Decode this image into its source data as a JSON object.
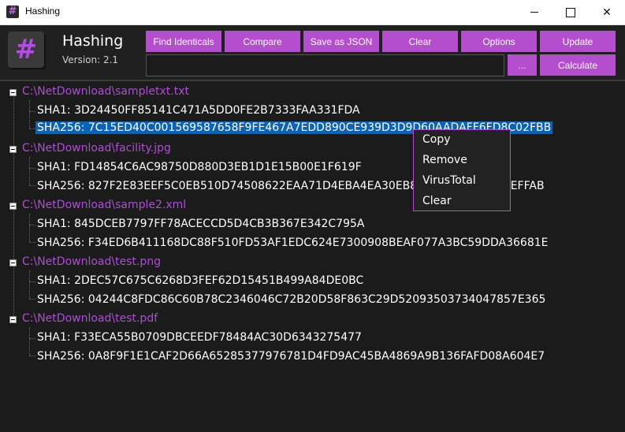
{
  "window": {
    "title": "Hashing",
    "icon": "hash-icon"
  },
  "header": {
    "logo_glyph": "#",
    "app_name": "Hashing",
    "version": "Version: 2.1",
    "buttons": {
      "find_identicals": "Find Identicals",
      "compare": "Compare",
      "save_json": "Save as JSON",
      "clear": "Clear",
      "options": "Options",
      "update": "Update",
      "browse": "...",
      "calculate": "Calculate"
    },
    "path_value": ""
  },
  "tree": [
    {
      "file": "C:\\NetDownload\\sampletxt.txt",
      "sha1": "SHA1: 3D24450FF85141C471A5DD0FE2B7333FAA331FDA",
      "sha256": "SHA256: 7C15ED40C001569587658F9FE467A7EDD890CE939D3D9D60AADAFF6FD8C02FBB"
    },
    {
      "file": "C:\\NetDownload\\facility.jpg",
      "sha1": "SHA1: FD14854C6AC98750D880D3EB1D1E15B00E1F619F",
      "sha256": "SHA256: 827F2E83EEF5C0EB510D74508622EAA71D4EBA4EA30EB8B2C9B7A5F3E4BEFFAB"
    },
    {
      "file": "C:\\NetDownload\\sample2.xml",
      "sha1": "SHA1: 845DCEB7797FF78ACECCD5D4CB3B367E342C795A",
      "sha256": "SHA256: F34ED6B411168DC88F510FD53AF1EDC624E7300908BEAF077A3BC59DDA36681E"
    },
    {
      "file": "C:\\NetDownload\\test.png",
      "sha1": "SHA1: 2DEC57C675C6268D3FEF62D15451B499A84DE0BC",
      "sha256": "SHA256: 04244C8FDC86C60B78C2346046C72B20D58F863C29D52093503734047857E365"
    },
    {
      "file": "C:\\NetDownload\\test.pdf",
      "sha1": "SHA1: F33ECA55B0709DBCEEDF78484AC30D6343275477",
      "sha256": "SHA256: 0A8F9F1E1CAF2D66A65285377976781D4FD9AC45BA4869A9B136FAFD08A604E7"
    }
  ],
  "context_menu": {
    "items": [
      "Copy",
      "Remove",
      "VirusTotal",
      "Clear"
    ]
  },
  "colors": {
    "accent": "#b44ecf",
    "file_text": "#b04cd8",
    "selection": "#0a63b6",
    "background": "#1b1b1b"
  }
}
